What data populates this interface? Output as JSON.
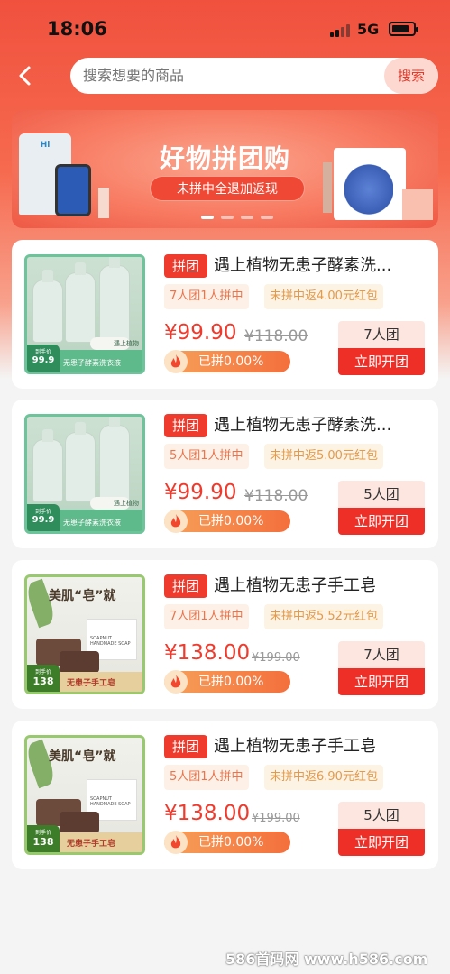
{
  "status_bar": {
    "time": "18:06",
    "network": "5G"
  },
  "search": {
    "placeholder": "搜索想要的商品",
    "button_label": "搜索"
  },
  "banner": {
    "title": "好物拼团购",
    "subtitle": "未拼中全退加返现",
    "slides": 4,
    "active_slide": 0,
    "product_brand": "Hi"
  },
  "colors": {
    "accent": "#ef3b2d",
    "header_top": "#f0513e",
    "chip_bg": "#fdf0e6"
  },
  "products": [
    {
      "tag": "拼团",
      "title": "遇上植物无患子酵素洗...",
      "people": "7人团1人拼中",
      "refund": "未拼中返4.00元红包",
      "price": "¥99.90",
      "original_price": "¥118.00",
      "progress": "已拼0.00%",
      "progress_value": 0.0,
      "group_size": "7人团",
      "cta": "立即开团",
      "image": {
        "caption": "无患子酵素洗衣液",
        "price_label": "到手价",
        "price": "99.9",
        "brand": "遇上植物"
      }
    },
    {
      "tag": "拼团",
      "title": "遇上植物无患子酵素洗...",
      "people": "5人团1人拼中",
      "refund": "未拼中返5.00元红包",
      "price": "¥99.90",
      "original_price": "¥118.00",
      "progress": "已拼0.00%",
      "progress_value": 0.0,
      "group_size": "5人团",
      "cta": "立即开团",
      "image": {
        "caption": "无患子酵素洗衣液",
        "price_label": "到手价",
        "price": "99.9",
        "brand": "遇上植物"
      }
    },
    {
      "tag": "拼团",
      "title": "遇上植物无患子手工皂",
      "people": "7人团1人拼中",
      "refund": "未拼中返5.52元红包",
      "price": "¥138.00",
      "original_price": "¥199.00",
      "progress": "已拼0.00%",
      "progress_value": 0.0,
      "group_size": "7人团",
      "cta": "立即开团",
      "image": {
        "headline": "美肌“皂”就",
        "caption": "无患子手工皂",
        "price_label": "到手价",
        "price": "138",
        "box_label": "SOAPNUT HANDMADE SOAP"
      }
    },
    {
      "tag": "拼团",
      "title": "遇上植物无患子手工皂",
      "people": "5人团1人拼中",
      "refund": "未拼中返6.90元红包",
      "price": "¥138.00",
      "original_price": "¥199.00",
      "progress": "已拼0.00%",
      "progress_value": 0.0,
      "group_size": "5人团",
      "cta": "立即开团",
      "image": {
        "headline": "美肌“皂”就",
        "caption": "无患子手工皂",
        "price_label": "到手价",
        "price": "138",
        "box_label": "SOAPNUT HANDMADE SOAP"
      }
    }
  ],
  "watermark": "586首码网 www.h586.com"
}
